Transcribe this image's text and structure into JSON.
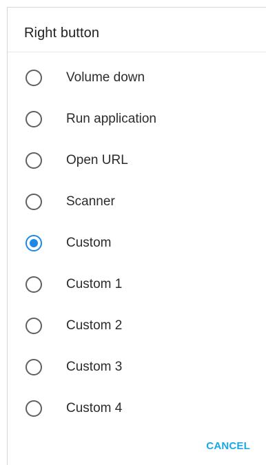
{
  "dialog": {
    "title": "Right button",
    "options": [
      {
        "label": "Volume down",
        "checked": false
      },
      {
        "label": "Run application",
        "checked": false
      },
      {
        "label": "Open URL",
        "checked": false
      },
      {
        "label": "Scanner",
        "checked": false
      },
      {
        "label": "Custom",
        "checked": true
      },
      {
        "label": "Custom 1",
        "checked": false
      },
      {
        "label": "Custom 2",
        "checked": false
      },
      {
        "label": "Custom 3",
        "checked": false
      },
      {
        "label": "Custom 4",
        "checked": false
      }
    ],
    "cancel_label": "CANCEL"
  },
  "colors": {
    "accent": "#1e88e5",
    "cancel": "#1aa7e8",
    "radio_unchecked": "#5f5f5f",
    "text": "#2b2b2b"
  }
}
